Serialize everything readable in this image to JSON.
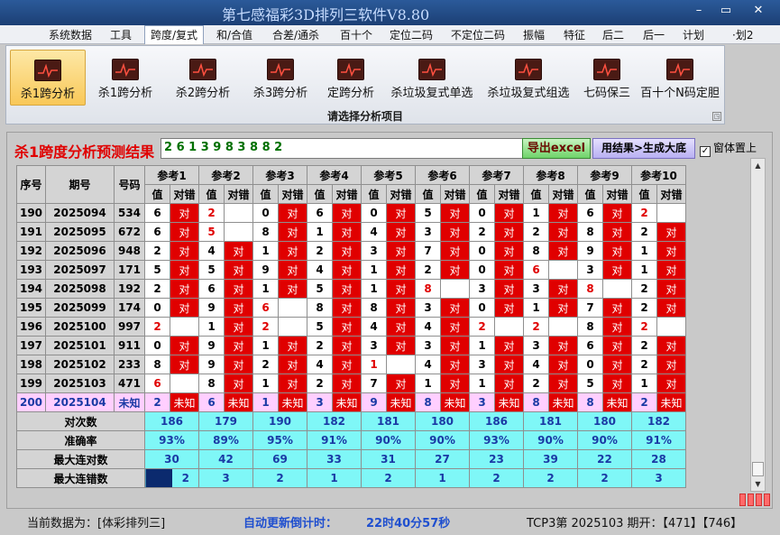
{
  "window": {
    "title": "第七感福彩3D排列三软件V8.80",
    "controls": [
      "–",
      "▭",
      "✕"
    ]
  },
  "menu": {
    "items": [
      "系统数据",
      "工具",
      "跨度/复式",
      "和/合值",
      "合差/通杀",
      "百十个",
      "定位二码",
      "不定位二码",
      "振幅",
      "特征",
      "后二",
      "后一",
      "计划",
      "·划2"
    ],
    "active_index": 2
  },
  "ribbon": {
    "buttons": [
      "杀1跨分析",
      "杀1跨分析",
      "杀2跨分析",
      "杀3跨分析",
      "定跨分析",
      "杀垃圾复式单选",
      "杀垃圾复式组选",
      "七码保三",
      "百十个N码定胆"
    ],
    "active_index": 0,
    "group_label": "请选择分析项目",
    "expand_icon": "◳"
  },
  "analysis": {
    "title": "杀1跨度分析预测结果",
    "result_value": "2 6 1 3 9 8 3 8 8 2",
    "export_button": "导出excel",
    "generate_button": "用结果>生成大底",
    "ontop_label": "窗体置上",
    "ontop_checked": true,
    "ontop_mark": "✓"
  },
  "table": {
    "headers": [
      "序号",
      "期号",
      "号码"
    ],
    "ref_headers": [
      "参考1",
      "参考2",
      "参考3",
      "参考4",
      "参考5",
      "参考6",
      "参考7",
      "参考8",
      "参考9",
      "参考10"
    ],
    "sub_headers": [
      "值",
      "对错"
    ],
    "rows": [
      {
        "seq": "190",
        "issue": "2025094",
        "num": "534",
        "refs": [
          [
            "6",
            "对"
          ],
          [
            "2",
            ""
          ],
          [
            "0",
            "对"
          ],
          [
            "6",
            "对"
          ],
          [
            "0",
            "对"
          ],
          [
            "5",
            "对"
          ],
          [
            "0",
            "对"
          ],
          [
            "1",
            "对"
          ],
          [
            "6",
            "对"
          ],
          [
            "2",
            ""
          ]
        ]
      },
      {
        "seq": "191",
        "issue": "2025095",
        "num": "672",
        "refs": [
          [
            "6",
            "对"
          ],
          [
            "5",
            ""
          ],
          [
            "8",
            "对"
          ],
          [
            "1",
            "对"
          ],
          [
            "4",
            "对"
          ],
          [
            "3",
            "对"
          ],
          [
            "2",
            "对"
          ],
          [
            "2",
            "对"
          ],
          [
            "8",
            "对"
          ],
          [
            "2",
            "对"
          ]
        ]
      },
      {
        "seq": "192",
        "issue": "2025096",
        "num": "948",
        "refs": [
          [
            "2",
            "对"
          ],
          [
            "4",
            "对"
          ],
          [
            "1",
            "对"
          ],
          [
            "2",
            "对"
          ],
          [
            "3",
            "对"
          ],
          [
            "7",
            "对"
          ],
          [
            "0",
            "对"
          ],
          [
            "8",
            "对"
          ],
          [
            "9",
            "对"
          ],
          [
            "1",
            "对"
          ]
        ]
      },
      {
        "seq": "193",
        "issue": "2025097",
        "num": "171",
        "refs": [
          [
            "5",
            "对"
          ],
          [
            "5",
            "对"
          ],
          [
            "9",
            "对"
          ],
          [
            "4",
            "对"
          ],
          [
            "1",
            "对"
          ],
          [
            "2",
            "对"
          ],
          [
            "0",
            "对"
          ],
          [
            "6",
            ""
          ],
          [
            "3",
            "对"
          ],
          [
            "1",
            "对"
          ]
        ]
      },
      {
        "seq": "194",
        "issue": "2025098",
        "num": "192",
        "refs": [
          [
            "2",
            "对"
          ],
          [
            "6",
            "对"
          ],
          [
            "1",
            "对"
          ],
          [
            "5",
            "对"
          ],
          [
            "1",
            "对"
          ],
          [
            "8",
            ""
          ],
          [
            "3",
            "对"
          ],
          [
            "3",
            "对"
          ],
          [
            "8",
            ""
          ],
          [
            "2",
            "对"
          ]
        ]
      },
      {
        "seq": "195",
        "issue": "2025099",
        "num": "174",
        "refs": [
          [
            "0",
            "对"
          ],
          [
            "9",
            "对"
          ],
          [
            "6",
            ""
          ],
          [
            "8",
            "对"
          ],
          [
            "8",
            "对"
          ],
          [
            "3",
            "对"
          ],
          [
            "0",
            "对"
          ],
          [
            "1",
            "对"
          ],
          [
            "7",
            "对"
          ],
          [
            "2",
            "对"
          ]
        ]
      },
      {
        "seq": "196",
        "issue": "2025100",
        "num": "997",
        "refs": [
          [
            "2",
            ""
          ],
          [
            "1",
            "对"
          ],
          [
            "2",
            ""
          ],
          [
            "5",
            "对"
          ],
          [
            "4",
            "对"
          ],
          [
            "4",
            "对"
          ],
          [
            "2",
            ""
          ],
          [
            "2",
            ""
          ],
          [
            "8",
            "对"
          ],
          [
            "2",
            ""
          ]
        ]
      },
      {
        "seq": "197",
        "issue": "2025101",
        "num": "911",
        "refs": [
          [
            "0",
            "对"
          ],
          [
            "9",
            "对"
          ],
          [
            "1",
            "对"
          ],
          [
            "2",
            "对"
          ],
          [
            "3",
            "对"
          ],
          [
            "3",
            "对"
          ],
          [
            "1",
            "对"
          ],
          [
            "3",
            "对"
          ],
          [
            "6",
            "对"
          ],
          [
            "2",
            "对"
          ]
        ]
      },
      {
        "seq": "198",
        "issue": "2025102",
        "num": "233",
        "refs": [
          [
            "8",
            "对"
          ],
          [
            "9",
            "对"
          ],
          [
            "2",
            "对"
          ],
          [
            "4",
            "对"
          ],
          [
            "1",
            ""
          ],
          [
            "4",
            "对"
          ],
          [
            "3",
            "对"
          ],
          [
            "4",
            "对"
          ],
          [
            "0",
            "对"
          ],
          [
            "2",
            "对"
          ]
        ]
      },
      {
        "seq": "199",
        "issue": "2025103",
        "num": "471",
        "refs": [
          [
            "6",
            ""
          ],
          [
            "8",
            "对"
          ],
          [
            "1",
            "对"
          ],
          [
            "2",
            "对"
          ],
          [
            "7",
            "对"
          ],
          [
            "1",
            "对"
          ],
          [
            "1",
            "对"
          ],
          [
            "2",
            "对"
          ],
          [
            "5",
            "对"
          ],
          [
            "1",
            "对"
          ]
        ]
      },
      {
        "seq": "200",
        "issue": "2025104",
        "num": "未知",
        "refs": [
          [
            "2",
            "未知"
          ],
          [
            "6",
            "未知"
          ],
          [
            "1",
            "未知"
          ],
          [
            "3",
            "未知"
          ],
          [
            "9",
            "未知"
          ],
          [
            "8",
            "未知"
          ],
          [
            "3",
            "未知"
          ],
          [
            "8",
            "未知"
          ],
          [
            "8",
            "未知"
          ],
          [
            "2",
            "未知"
          ]
        ]
      }
    ],
    "stats": [
      {
        "label": "对次数",
        "values": [
          "186",
          "179",
          "190",
          "182",
          "181",
          "180",
          "186",
          "181",
          "180",
          "182"
        ]
      },
      {
        "label": "准确率",
        "values": [
          "93%",
          "89%",
          "95%",
          "91%",
          "90%",
          "90%",
          "93%",
          "90%",
          "90%",
          "91%"
        ]
      },
      {
        "label": "最大连对数",
        "values": [
          "30",
          "42",
          "69",
          "33",
          "31",
          "27",
          "23",
          "39",
          "22",
          "28"
        ]
      },
      {
        "label": "最大连错数",
        "values": [
          "2",
          "3",
          "2",
          "1",
          "2",
          "1",
          "2",
          "2",
          "2",
          "3"
        ]
      }
    ]
  },
  "status": {
    "current_data": "当前数据为：[体彩排列三]",
    "countdown_label": "自动更新倒计时：",
    "countdown_value": "22时40分57秒",
    "draw_info": "TCP3第 2025103 期开：【471】【746】"
  },
  "colors": {
    "hit": "#e00000",
    "miss_value": "#e00000",
    "unknown_bg": "#ffcfff",
    "stats_bg": "#7ff7f7",
    "stats_text": "#1a3aa5",
    "title_red": "#e00000"
  }
}
